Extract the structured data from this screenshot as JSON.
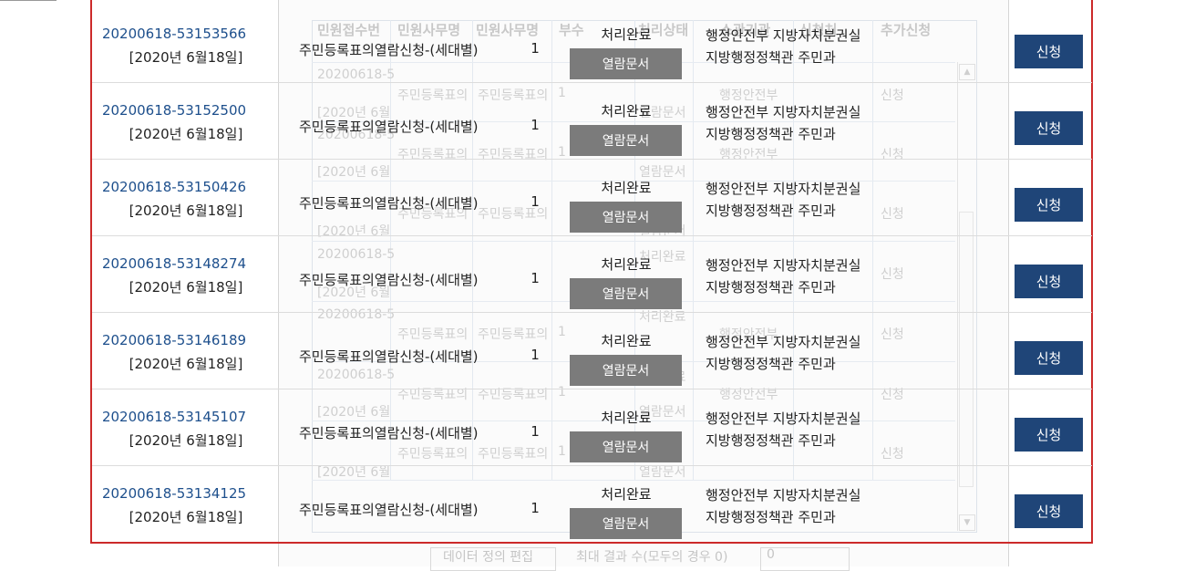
{
  "rows": [
    {
      "id": "20200618-53153566",
      "date": "[2020년 6월18일]",
      "name": "주민등록표의열람신청-(세대별)",
      "count": "1",
      "status": "처리완료",
      "doc_button": "열람문서",
      "org_line1": "행정안전부 지방자치분권실",
      "org_line2": "지방행정정책관 주민과",
      "apply_button": "신청"
    },
    {
      "id": "20200618-53152500",
      "date": "[2020년 6월18일]",
      "name": "주민등록표의열람신청-(세대별)",
      "count": "1",
      "status": "처리완료",
      "doc_button": "열람문서",
      "org_line1": "행정안전부 지방자치분권실",
      "org_line2": "지방행정정책관 주민과",
      "apply_button": "신청"
    },
    {
      "id": "20200618-53150426",
      "date": "[2020년 6월18일]",
      "name": "주민등록표의열람신청-(세대별)",
      "count": "1",
      "status": "처리완료",
      "doc_button": "열람문서",
      "org_line1": "행정안전부 지방자치분권실",
      "org_line2": "지방행정정책관 주민과",
      "apply_button": "신청"
    },
    {
      "id": "20200618-53148274",
      "date": "[2020년 6월18일]",
      "name": "주민등록표의열람신청-(세대별)",
      "count": "1",
      "status": "처리완료",
      "doc_button": "열람문서",
      "org_line1": "행정안전부 지방자치분권실",
      "org_line2": "지방행정정책관 주민과",
      "apply_button": "신청"
    },
    {
      "id": "20200618-53146189",
      "date": "[2020년 6월18일]",
      "name": "주민등록표의열람신청-(세대별)",
      "count": "1",
      "status": "처리완료",
      "doc_button": "열람문서",
      "org_line1": "행정안전부 지방자치분권실",
      "org_line2": "지방행정정책관 주민과",
      "apply_button": "신청"
    },
    {
      "id": "20200618-53145107",
      "date": "[2020년 6월18일]",
      "name": "주민등록표의열람신청-(세대별)",
      "count": "1",
      "status": "처리완료",
      "doc_button": "열람문서",
      "org_line1": "행정안전부 지방자치분권실",
      "org_line2": "지방행정정책관 주민과",
      "apply_button": "신청"
    },
    {
      "id": "20200618-53134125",
      "date": "[2020년 6월18일]",
      "name": "주민등록표의열람신청-(세대별)",
      "count": "1",
      "status": "처리완료",
      "doc_button": "열람문서",
      "org_line1": "행정안전부 지방자치분권실",
      "org_line2": "지방행정정책관 주민과",
      "apply_button": "신청"
    }
  ],
  "ghost": {
    "headers": [
      "민원접수번",
      "민원사무명",
      "민원사무명",
      "부수",
      "처리상태",
      "소관기관",
      "신청처",
      "추가신청"
    ],
    "id_prefix": "20200618-5",
    "date_prefix": "[2020년 6월",
    "name_cut": "주민등록표의",
    "count": "1",
    "status": "처리완료",
    "doc": "열람문서",
    "org": "행정안전부",
    "apply": "신청",
    "edit_button": "데이터 정의 편집",
    "max_label": "최대 결과 수(모두의 경우 0)",
    "max_value": "0"
  },
  "colors": {
    "accent": "#1f4578",
    "link": "#1d4f8c",
    "highlight_border": "#cc2a2a",
    "doc_button": "#7b7b7b"
  }
}
